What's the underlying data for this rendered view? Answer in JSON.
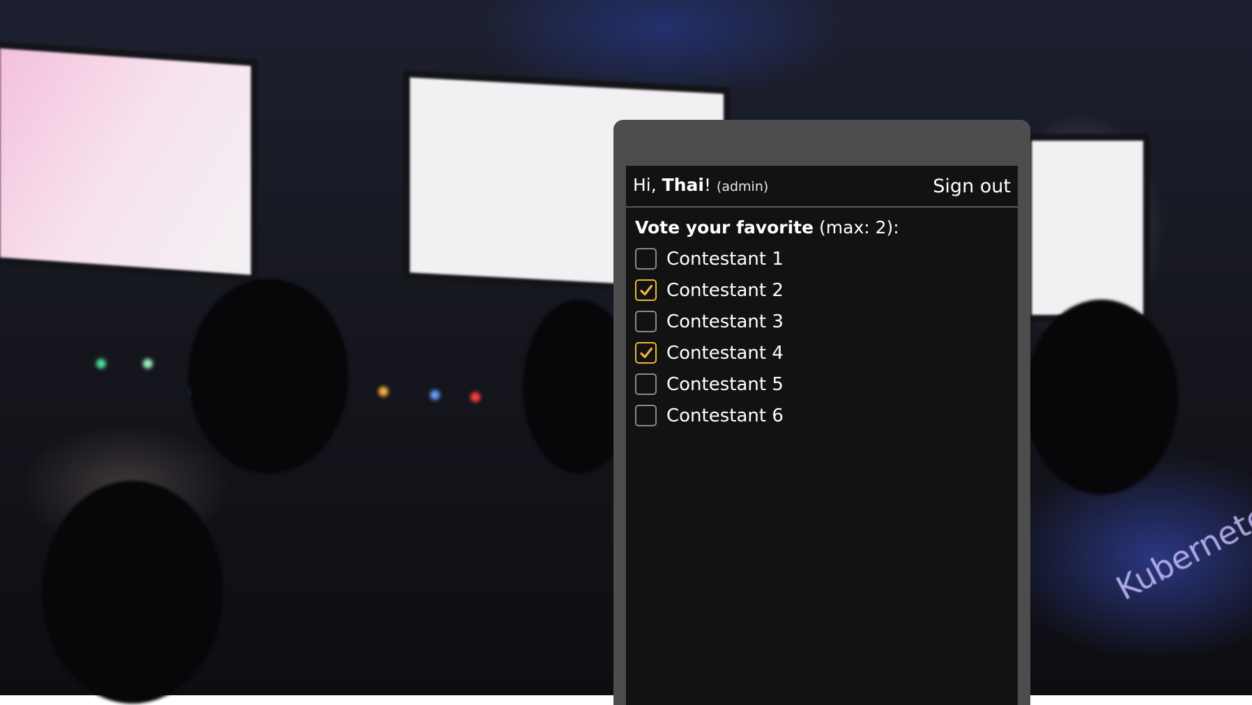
{
  "header": {
    "greeting_prefix": "Hi, ",
    "user_name": "Thai",
    "exclaim": "!",
    "role": "(admin)",
    "sign_out_label": "Sign out"
  },
  "vote": {
    "heading_bold": "Vote your favorite",
    "heading_rest": " (max: 2):",
    "options": [
      {
        "label": "Contestant 1",
        "checked": false
      },
      {
        "label": "Contestant 2",
        "checked": true
      },
      {
        "label": "Contestant 3",
        "checked": false
      },
      {
        "label": "Contestant 4",
        "checked": true
      },
      {
        "label": "Contestant 5",
        "checked": false
      },
      {
        "label": "Contestant 6",
        "checked": false
      }
    ]
  },
  "background": {
    "shirt_text": "Kubernetes"
  },
  "colors": {
    "accent": "#f0b43c",
    "screen_bg": "#121212",
    "frame": "#4d4d4d"
  }
}
